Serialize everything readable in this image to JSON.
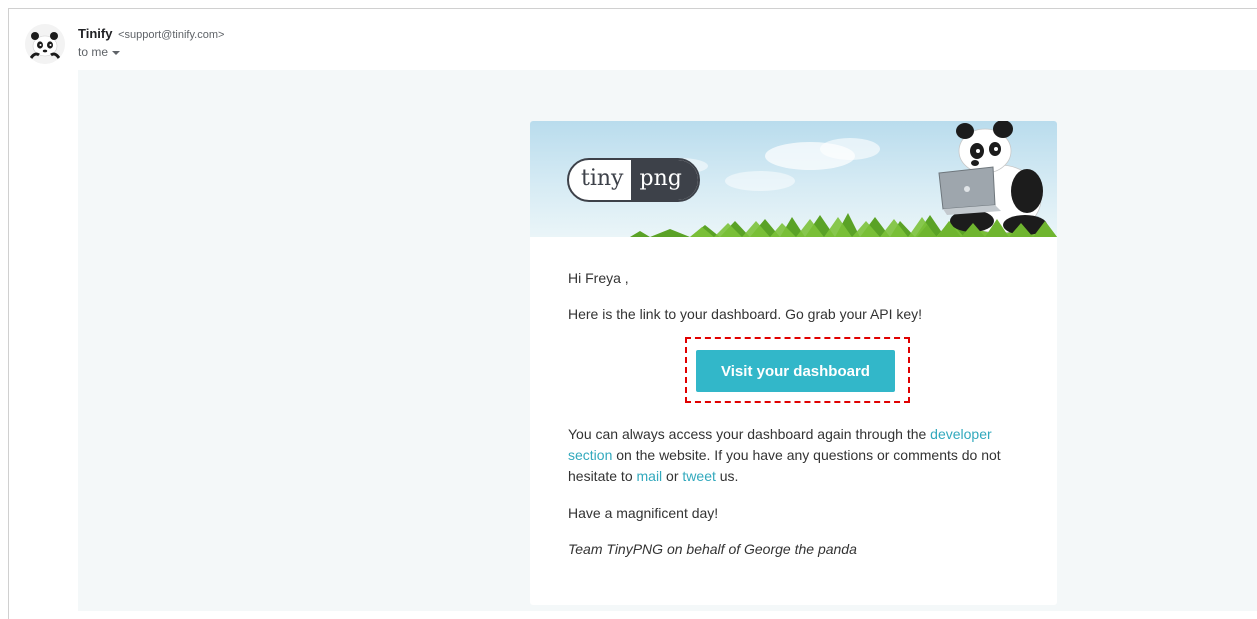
{
  "header": {
    "sender_name": "Tinify",
    "sender_email": "<support@tinify.com>",
    "to_label": "to me"
  },
  "banner": {
    "logo_left": "tiny",
    "logo_right": "png"
  },
  "body": {
    "greeting": "Hi Freya ,",
    "intro": "Here is the link to your dashboard. Go grab your API key!",
    "cta_label": "Visit your dashboard",
    "para_part1": "You can always access your dashboard again through the ",
    "developer_link_part1": "developer",
    "developer_link_part2": "section",
    "para_part2": " on the website. If you have any questions or comments do not hesitate to ",
    "mail_link": "mail",
    "para_part3": " or ",
    "tweet_link": "tweet",
    "para_part4": " us.",
    "closing": "Have a magnificent day!",
    "signature": "Team TinyPNG on behalf of George the panda"
  },
  "colors": {
    "accent": "#32b7c9",
    "link": "#32a9bd",
    "highlight": "#e00000",
    "email_bg": "#f4f8f9"
  },
  "icons": {
    "avatar": "panda-avatar",
    "caret": "chevron-down-icon",
    "mascot": "panda-with-laptop"
  }
}
